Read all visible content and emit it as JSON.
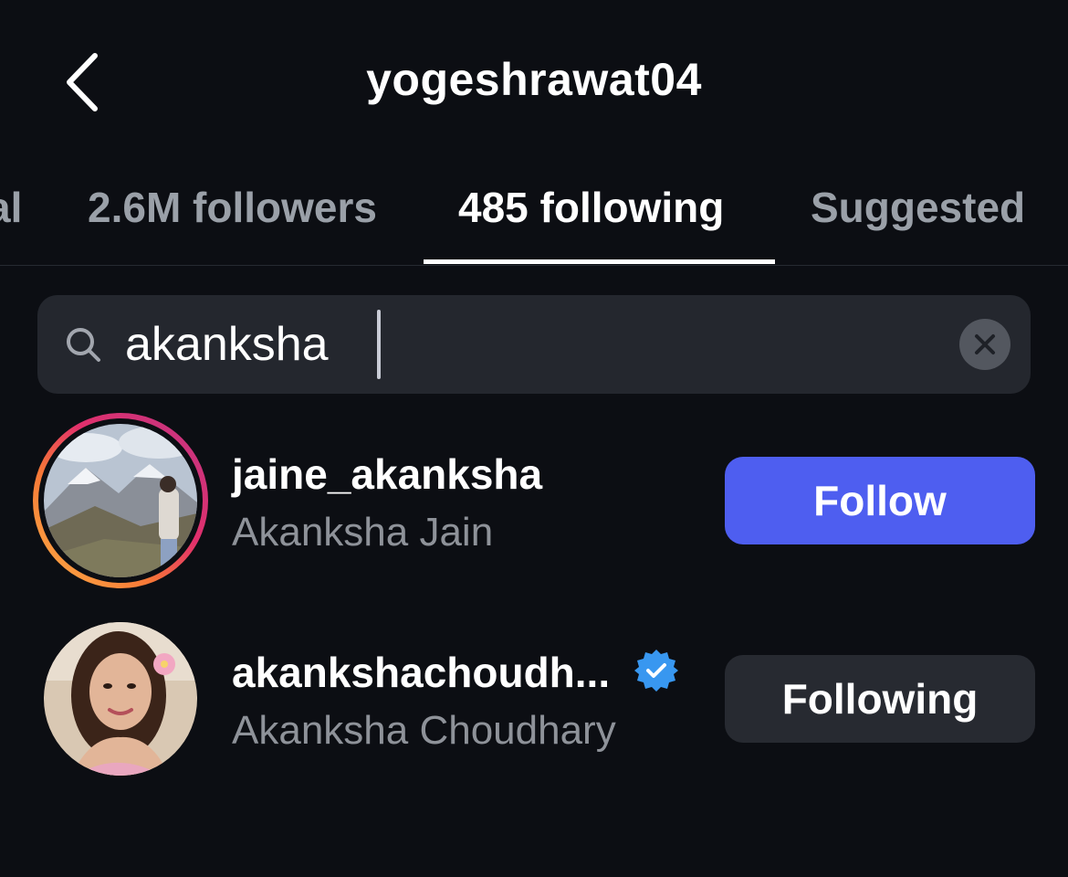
{
  "header": {
    "title": "yogeshrawat04",
    "back_icon": "chevron-left-icon"
  },
  "tabs": [
    {
      "label": "al",
      "active": false
    },
    {
      "label": "2.6M followers",
      "active": false
    },
    {
      "label": "485 following",
      "active": true
    },
    {
      "label": "Suggested",
      "active": false
    }
  ],
  "search": {
    "value": "akanksha",
    "icon": "search-icon",
    "clear_icon": "clear-icon"
  },
  "results": [
    {
      "username": "jaine_akanksha",
      "full_name": "Akanksha Jain",
      "verified": false,
      "has_story_ring": true,
      "button_label": "Follow"
    },
    {
      "username": "akankshachoudh...",
      "full_name": "Akanksha Choudhary",
      "verified": true,
      "has_story_ring": false,
      "button_label": "Following"
    }
  ],
  "colors": {
    "background": "#0c0e13",
    "follow_button": "#4e5ef0",
    "following_button": "#272a31",
    "verified_badge": "#3897f0",
    "secondary_text": "#8e9299"
  }
}
